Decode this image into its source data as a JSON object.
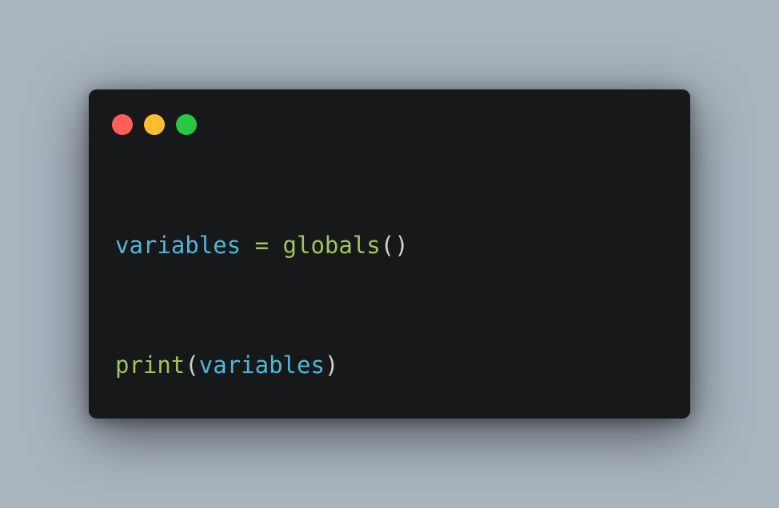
{
  "window": {
    "controls": [
      {
        "name": "close",
        "color": "#fe5f57"
      },
      {
        "name": "minimize",
        "color": "#febc2e"
      },
      {
        "name": "maximize",
        "color": "#28c840"
      }
    ]
  },
  "code": {
    "lines": [
      {
        "tokens": [
          {
            "text": "variables",
            "kind": "variable"
          },
          {
            "text": " ",
            "kind": "space"
          },
          {
            "text": "=",
            "kind": "operator"
          },
          {
            "text": " ",
            "kind": "space"
          },
          {
            "text": "globals",
            "kind": "function"
          },
          {
            "text": "()",
            "kind": "punctuation"
          }
        ]
      },
      {
        "tokens": [
          {
            "text": "print",
            "kind": "function"
          },
          {
            "text": "(",
            "kind": "punctuation"
          },
          {
            "text": "variables",
            "kind": "variable"
          },
          {
            "text": ")",
            "kind": "punctuation"
          }
        ]
      }
    ]
  },
  "colors": {
    "background": "#a9b4bf",
    "window": "#17181a",
    "variable": "#4fb6d8",
    "function": "#9dc55b",
    "punctuation": "#d0d0d0"
  }
}
